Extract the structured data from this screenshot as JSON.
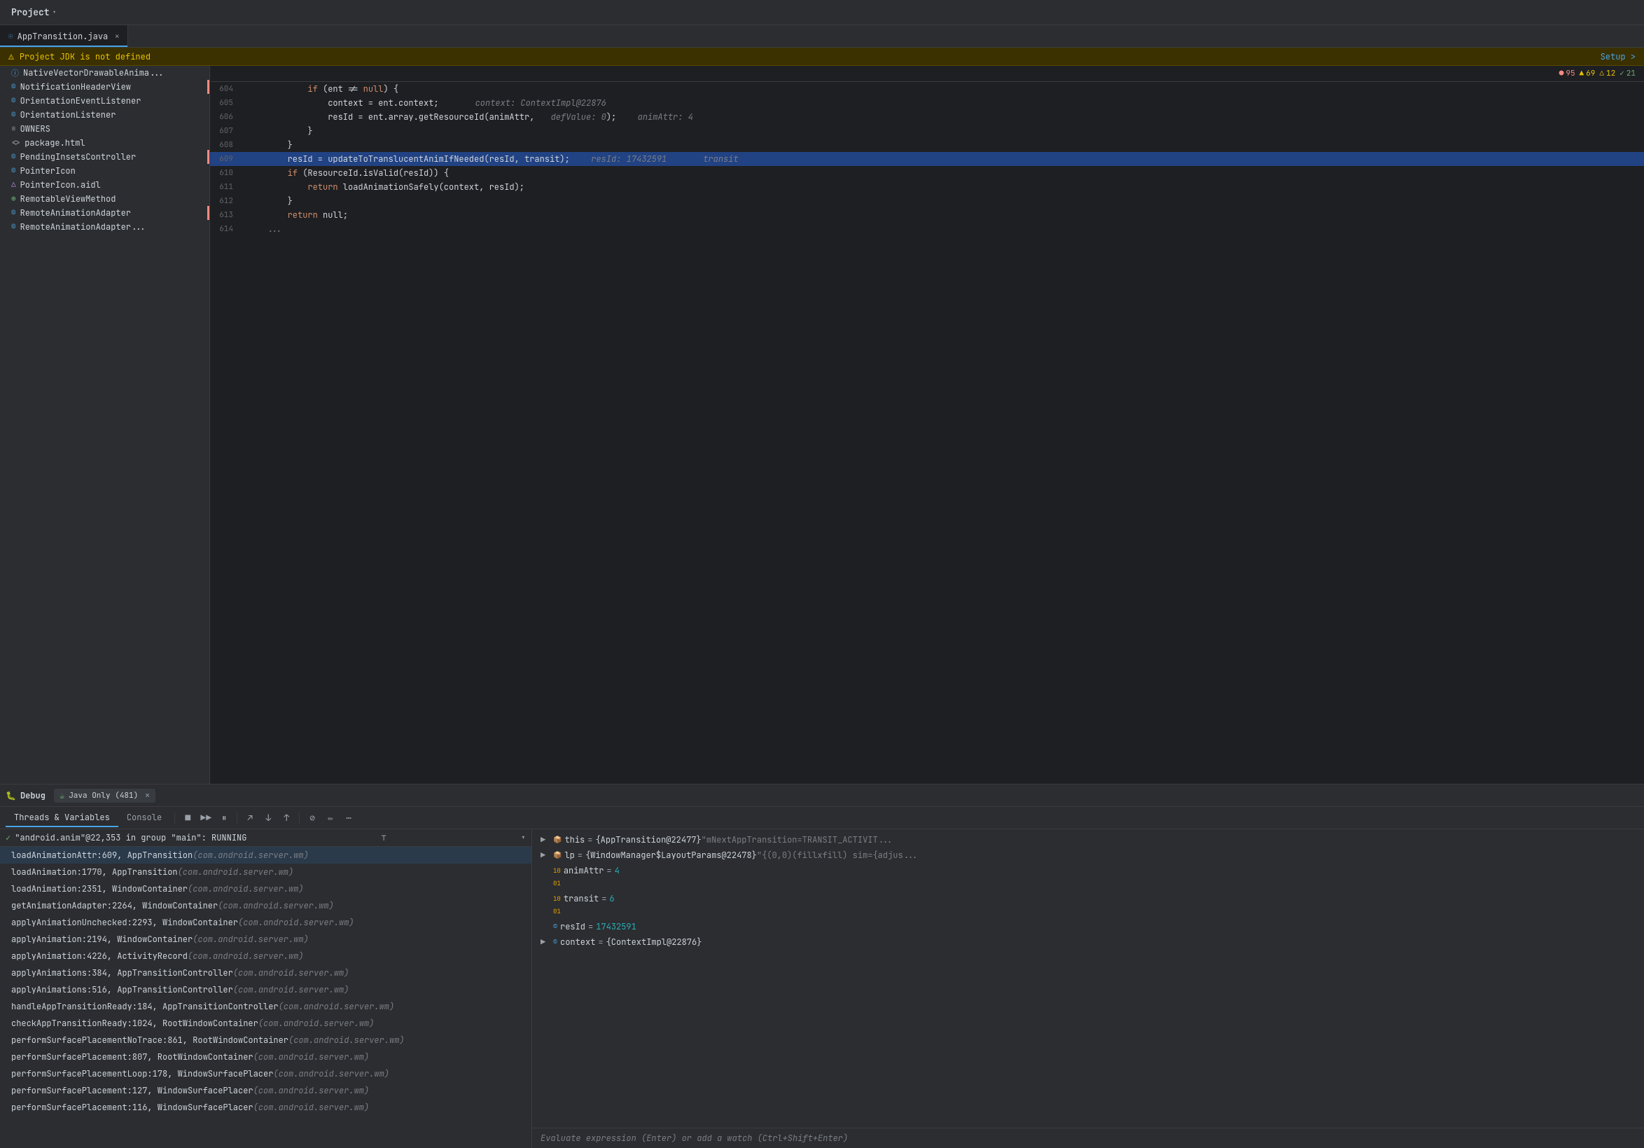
{
  "topbar": {
    "project_label": "Project",
    "chevron": "▾"
  },
  "tabs": [
    {
      "icon": "☉",
      "name": "AppTransition.java",
      "active": true,
      "closable": true
    }
  ],
  "warning": {
    "icon": "⚠",
    "message": "Project JDK is not defined",
    "action": "Setup >"
  },
  "error_bar": {
    "errors": [
      {
        "icon": "●",
        "count": "95",
        "color": "err-red"
      },
      {
        "icon": "▲",
        "count": "69",
        "color": "err-yellow"
      },
      {
        "icon": "△",
        "count": "12",
        "color": "err-yellow"
      },
      {
        "icon": "✓",
        "count": "21",
        "color": "err-green"
      }
    ]
  },
  "tree_items": [
    {
      "icon": "ⓘ",
      "icon_class": "icon-blue",
      "name": "NativeVectorDrawableAnima..."
    },
    {
      "icon": "©",
      "icon_class": "icon-blue",
      "name": "NotificationHeaderView",
      "has_error": true
    },
    {
      "icon": "©",
      "icon_class": "icon-blue",
      "name": "OrientationEventListener"
    },
    {
      "icon": "©",
      "icon_class": "icon-blue",
      "name": "OrientationListener"
    },
    {
      "icon": "≡",
      "icon_class": "icon-gray",
      "name": "OWNERS"
    },
    {
      "icon": "<>",
      "icon_class": "icon-gray",
      "name": "package.html"
    },
    {
      "icon": "©",
      "icon_class": "icon-blue",
      "name": "PendingInsetsController",
      "has_error": true
    },
    {
      "icon": "©",
      "icon_class": "icon-blue",
      "name": "PointerIcon"
    },
    {
      "icon": "△",
      "icon_class": "icon-purple",
      "name": "PointerIcon.aidl"
    },
    {
      "icon": "⊕",
      "icon_class": "icon-green",
      "name": "RemotableViewMethod"
    },
    {
      "icon": "©",
      "icon_class": "icon-blue",
      "name": "RemoteAnimationAdapter",
      "has_error": true
    },
    {
      "icon": "©",
      "icon_class": "icon-blue",
      "name": "RemoteAnimationAdapter..."
    }
  ],
  "code_lines": [
    {
      "num": "604",
      "tokens": [
        {
          "text": "            ",
          "cls": ""
        },
        {
          "text": "if",
          "cls": "kw"
        },
        {
          "text": " (ent != ",
          "cls": "var"
        },
        {
          "text": "null",
          "cls": "kw"
        },
        {
          "text": ") {",
          "cls": "var"
        }
      ],
      "hint": null,
      "highlighted": false
    },
    {
      "num": "605",
      "tokens": [
        {
          "text": "                context = ent.context;",
          "cls": "var"
        },
        {
          "text": "     context: ContextImpl@22876",
          "cls": "hint"
        }
      ],
      "highlighted": false
    },
    {
      "num": "606",
      "tokens": [
        {
          "text": "                resId = ent.array.getResourceId(animAttr,",
          "cls": "var"
        },
        {
          "text": " defValue: 0",
          "cls": "hint"
        },
        {
          "text": ");",
          "cls": "var"
        },
        {
          "text": "  animAttr: 4",
          "cls": "hint"
        }
      ],
      "highlighted": false
    },
    {
      "num": "607",
      "tokens": [
        {
          "text": "            }",
          "cls": "var"
        }
      ],
      "highlighted": false
    },
    {
      "num": "608",
      "tokens": [
        {
          "text": "        }",
          "cls": "var"
        }
      ],
      "highlighted": false
    },
    {
      "num": "609",
      "tokens": [
        {
          "text": "        resId = updateToTranslucentAnimIfNeeded(resId, transit);",
          "cls": "var"
        },
        {
          "text": "  resId: 17432591",
          "cls": "hint"
        },
        {
          "text": "     transit",
          "cls": "hint"
        }
      ],
      "highlighted": true
    },
    {
      "num": "610",
      "tokens": [
        {
          "text": "        ",
          "cls": ""
        },
        {
          "text": "if",
          "cls": "kw"
        },
        {
          "text": " (ResourceId.isValid(resId)) {",
          "cls": "var"
        }
      ],
      "highlighted": false
    },
    {
      "num": "611",
      "tokens": [
        {
          "text": "            ",
          "cls": ""
        },
        {
          "text": "return",
          "cls": "kw"
        },
        {
          "text": " loadAnimationSafely(context, resId);",
          "cls": "var"
        }
      ],
      "highlighted": false
    },
    {
      "num": "612",
      "tokens": [
        {
          "text": "        }",
          "cls": "var"
        }
      ],
      "highlighted": false
    },
    {
      "num": "613",
      "tokens": [
        {
          "text": "        ",
          "cls": ""
        },
        {
          "text": "return",
          "cls": "kw"
        },
        {
          "text": " null;",
          "cls": "var"
        }
      ],
      "highlighted": false
    },
    {
      "num": "614",
      "tokens": [
        {
          "text": "    ...",
          "cls": "comment"
        }
      ],
      "highlighted": false
    }
  ],
  "debug": {
    "label": "Debug",
    "session_icon": "⚙",
    "session_text": "Java Only (481)",
    "tabs": [
      {
        "label": "Threads & Variables",
        "active": true
      },
      {
        "label": "Console",
        "active": false
      }
    ],
    "toolbar_buttons": [
      "■",
      "▶▶",
      "⏸",
      "↑",
      "⬇",
      "⬆",
      "⊘",
      "✏",
      "⋯"
    ],
    "thread_text": "\"android.anim\"@22,353 in group \"main\": RUNNING",
    "stack_frames": [
      {
        "method": "loadAnimationAttr:609, AppTransition",
        "pkg": "(com.android.server.wm)",
        "selected": true
      },
      {
        "method": "loadAnimation:1770, AppTransition",
        "pkg": "(com.android.server.wm)",
        "selected": false
      },
      {
        "method": "loadAnimation:2351, WindowContainer",
        "pkg": "(com.android.server.wm)",
        "selected": false
      },
      {
        "method": "getAnimationAdapter:2264, WindowContainer",
        "pkg": "(com.android.server.wm)",
        "selected": false
      },
      {
        "method": "applyAnimationUnchecked:2293, WindowContainer",
        "pkg": "(com.android.server.wm)",
        "selected": false
      },
      {
        "method": "applyAnimation:2194, WindowContainer",
        "pkg": "(com.android.server.wm)",
        "selected": false
      },
      {
        "method": "applyAnimation:4226, ActivityRecord",
        "pkg": "(com.android.server.wm)",
        "selected": false
      },
      {
        "method": "applyAnimations:384, AppTransitionController",
        "pkg": "(com.android.server.wm)",
        "selected": false
      },
      {
        "method": "applyAnimations:516, AppTransitionController",
        "pkg": "(com.android.server.wm)",
        "selected": false
      },
      {
        "method": "handleAppTransitionReady:184, AppTransitionController",
        "pkg": "(com.android.server.wm)",
        "selected": false
      },
      {
        "method": "checkAppTransitionReady:1024, RootWindowContainer",
        "pkg": "(com.android.server.wm)",
        "selected": false
      },
      {
        "method": "performSurfacePlacementNoTrace:861, RootWindowContainer",
        "pkg": "(com.android.server.wm)",
        "selected": false
      },
      {
        "method": "performSurfacePlacement:807, RootWindowContainer",
        "pkg": "(com.android.server.wm)",
        "selected": false
      },
      {
        "method": "performSurfacePlacementLoop:178, WindowSurfacePlacer",
        "pkg": "(com.android.server.wm)",
        "selected": false
      },
      {
        "method": "performSurfacePlacement:127, WindowSurfacePlacer",
        "pkg": "(com.android.server.wm)",
        "selected": false
      },
      {
        "method": "performSurfacePlacement:116, WindowSurfacePlacer",
        "pkg": "(com.android.server.wm)",
        "selected": false
      }
    ],
    "variables": [
      {
        "expand": "▶",
        "icon": "📦",
        "icon_color": "icon-blue",
        "name": "this",
        "eq": "=",
        "val": "{AppTransition@22477}",
        "hint": "\"mNextAppTransition=TRANSIT_ACTIVIT..."
      },
      {
        "expand": "▶",
        "icon": "📦",
        "icon_color": "icon-blue",
        "name": "lp",
        "eq": "=",
        "val": "{WindowManager$LayoutParams@22478}",
        "hint": "\"{(0,0)(fillxfill) sim={adjus..."
      },
      {
        "expand": null,
        "icon": "🔢",
        "icon_color": "icon-gray",
        "name": "animAttr",
        "eq": "=",
        "val": "4",
        "val_class": "var-val-num",
        "hint": ""
      },
      {
        "expand": null,
        "icon": "🔢",
        "icon_color": "icon-gray",
        "name": "transit",
        "eq": "=",
        "val": "6",
        "val_class": "var-val-num",
        "hint": ""
      },
      {
        "expand": null,
        "icon": "©",
        "icon_color": "icon-blue",
        "name": "resId",
        "eq": "=",
        "val": "17432591",
        "val_class": "var-val-num",
        "hint": ""
      },
      {
        "expand": "▶",
        "icon": "©",
        "icon_color": "icon-blue",
        "name": "context",
        "eq": "=",
        "val": "{ContextImpl@22876}",
        "val_class": "var-val-obj",
        "hint": ""
      }
    ],
    "eval_placeholder": "Evaluate expression (Enter) or add a watch (Ctrl+Shift+Enter)"
  }
}
